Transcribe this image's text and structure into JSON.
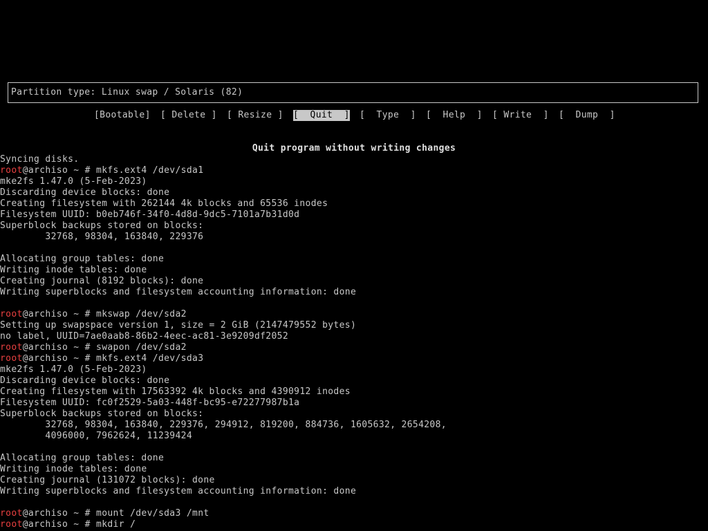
{
  "partition": {
    "type_label": "Partition type: Linux swap / Solaris (82)"
  },
  "menu": {
    "bootable": "[Bootable]",
    "delete": "[ Delete ]",
    "resize": "[ Resize ]",
    "quit": "[  Quit  ]",
    "type": "[  Type  ]",
    "help": "[  Help  ]",
    "write": "[ Write  ]",
    "dump": "[  Dump  ]",
    "selected": "quit"
  },
  "hint": "Quit program without writing changes",
  "prompt": {
    "user": "root",
    "host_suffix": "@archiso ~ # "
  },
  "terminal": {
    "l0": "Syncing disks.",
    "cmd1": "mkfs.ext4 /dev/sda1",
    "l2": "mke2fs 1.47.0 (5-Feb-2023)",
    "l3": "Discarding device blocks: done",
    "l4": "Creating filesystem with 262144 4k blocks and 65536 inodes",
    "l5": "Filesystem UUID: b0eb746f-34f0-4d8d-9dc5-7101a7b31d0d",
    "l6": "Superblock backups stored on blocks:",
    "l7": "        32768, 98304, 163840, 229376",
    "l9": "Allocating group tables: done",
    "l10": "Writing inode tables: done",
    "l11": "Creating journal (8192 blocks): done",
    "l12": "Writing superblocks and filesystem accounting information: done",
    "cmd2": "mkswap /dev/sda2",
    "l15": "Setting up swapspace version 1, size = 2 GiB (2147479552 bytes)",
    "l16": "no label, UUID=7ae0aab8-86b2-4eec-ac81-3e9209df2052",
    "cmd3": "swapon /dev/sda2",
    "cmd4": "mkfs.ext4 /dev/sda3",
    "l19": "mke2fs 1.47.0 (5-Feb-2023)",
    "l20": "Discarding device blocks: done",
    "l21": "Creating filesystem with 17563392 4k blocks and 4390912 inodes",
    "l22": "Filesystem UUID: fc0f2529-5a03-448f-bc95-e72277987b1a",
    "l23": "Superblock backups stored on blocks:",
    "l24": "        32768, 98304, 163840, 229376, 294912, 819200, 884736, 1605632, 2654208,",
    "l25": "        4096000, 7962624, 11239424",
    "l27": "Allocating group tables: done",
    "l28": "Writing inode tables: done",
    "l29": "Creating journal (131072 blocks): done",
    "l30": "Writing superblocks and filesystem accounting information: done",
    "cmd5": "mount /dev/sda3 /mnt",
    "cmd6": "mkdir /"
  }
}
